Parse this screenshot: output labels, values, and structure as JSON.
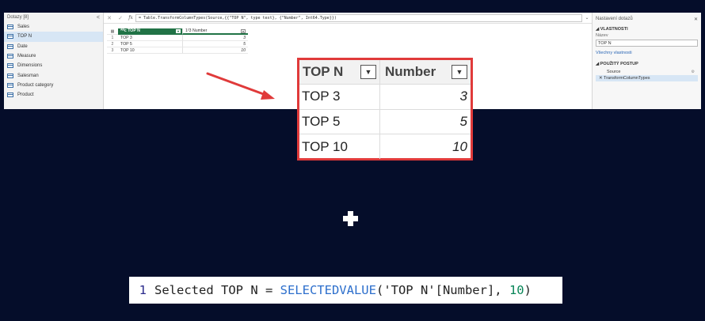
{
  "queries_pane": {
    "title": "Dotazy [8]",
    "collapse_glyph": "<",
    "items": [
      {
        "label": "Sales"
      },
      {
        "label": "TOP N"
      },
      {
        "label": "Date"
      },
      {
        "label": "Measure"
      },
      {
        "label": "Dimensions"
      },
      {
        "label": "Salesman"
      },
      {
        "label": "Product category"
      },
      {
        "label": "Product"
      }
    ],
    "selected_index": 1
  },
  "formula_bar": {
    "cancel_glyph": "✕",
    "confirm_glyph": "✓",
    "fx_label": "fx",
    "formula": "= Table.TransformColumnTypes(Source,{{\"TOP N\", type text}, {\"Number\", Int64.Type}})",
    "expand_glyph": "⌄"
  },
  "grid": {
    "type_icon_1": "ᴬᴮc",
    "type_icon_2": "1²3",
    "columns": [
      "TOP N",
      "Number"
    ],
    "rows": [
      {
        "index": "1",
        "top_n": "TOP 3",
        "number": "3"
      },
      {
        "index": "2",
        "top_n": "TOP 5",
        "number": "5"
      },
      {
        "index": "3",
        "top_n": "TOP 10",
        "number": "10"
      }
    ]
  },
  "settings_pane": {
    "title": "Nastavení dotazů",
    "close_glyph": "✕",
    "properties_header": "◢ VLASTNOSTI",
    "name_label": "Název",
    "name_value": "TOP N",
    "all_properties_link": "Všechny vlastnosti",
    "applied_steps_header": "◢ POUŽITÝ POSTUP",
    "steps": [
      {
        "label": "Source",
        "has_gear": true
      },
      {
        "label": "TransformColumnTypes",
        "has_gear": false
      }
    ],
    "selected_step_index": 1
  },
  "zoomed_table": {
    "columns": [
      "TOP N",
      "Number"
    ],
    "rows": [
      {
        "top_n": "TOP 3",
        "number": "3"
      },
      {
        "top_n": "TOP 5",
        "number": "5"
      },
      {
        "top_n": "TOP 10",
        "number": "10"
      }
    ],
    "border_color": "#e03a3a"
  },
  "plus_sign": "+",
  "dax_code": {
    "line_number": "1",
    "prefix": "Selected TOP N = ",
    "function": "SELECTEDVALUE",
    "open_paren": "(",
    "table_ref": "'TOP N'",
    "column_ref": "[Number], ",
    "default_value": "10",
    "close_paren": ")"
  },
  "colors": {
    "background": "#050d2a",
    "accent_green": "#217346",
    "highlight_red": "#e03a3a",
    "dax_function_blue": "#2d6fcc"
  }
}
